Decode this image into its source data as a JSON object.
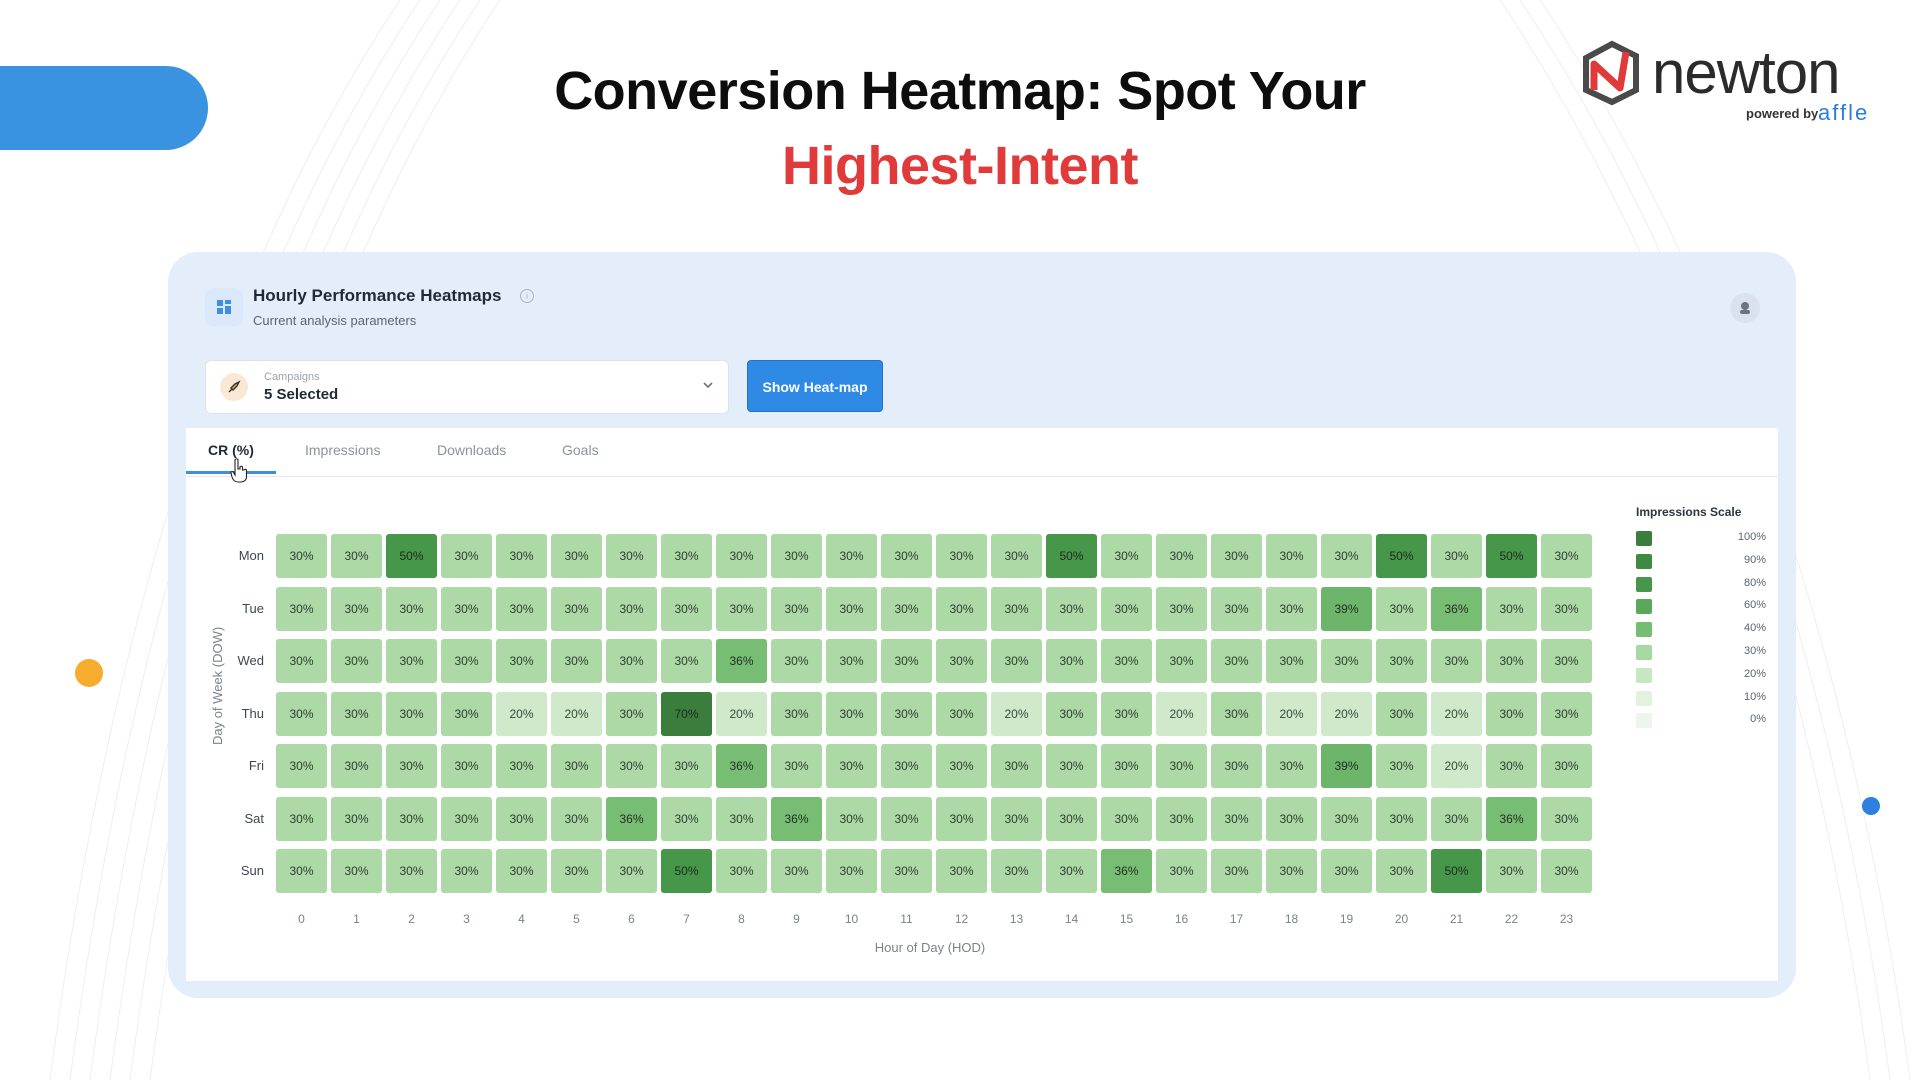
{
  "headline": {
    "line1": "Conversion Heatmap: Spot Your",
    "line2": "Highest-Intent"
  },
  "logo": {
    "word": "newton",
    "powered": "powered by",
    "brand": "affle"
  },
  "panel": {
    "title": "Hourly Performance Heatmaps",
    "subtitle": "Current analysis parameters",
    "campaign_label": "Campaigns",
    "campaign_value": "5 Selected",
    "show_button": "Show Heat-map"
  },
  "tabs": [
    {
      "label": "CR (%)",
      "active": true
    },
    {
      "label": "Impressions",
      "active": false
    },
    {
      "label": "Downloads",
      "active": false
    },
    {
      "label": "Goals",
      "active": false
    }
  ],
  "colors": {
    "accent": "#2f8ae5",
    "headline_red": "#e13a3a"
  },
  "chart_data": {
    "type": "heatmap",
    "ylabel": "Day of Week (DOW)",
    "xlabel": "Hour of Day (HOD)",
    "x": [
      "0",
      "1",
      "2",
      "3",
      "4",
      "5",
      "6",
      "7",
      "8",
      "9",
      "10",
      "11",
      "12",
      "13",
      "14",
      "15",
      "16",
      "17",
      "18",
      "19",
      "20",
      "21",
      "22",
      "23"
    ],
    "y": [
      "Mon",
      "Tue",
      "Wed",
      "Thu",
      "Fri",
      "Sat",
      "Sun"
    ],
    "values": [
      [
        30,
        30,
        50,
        30,
        30,
        30,
        30,
        30,
        30,
        30,
        30,
        30,
        30,
        30,
        50,
        30,
        30,
        30,
        30,
        30,
        50,
        30,
        50,
        30
      ],
      [
        30,
        30,
        30,
        30,
        30,
        30,
        30,
        30,
        30,
        30,
        30,
        30,
        30,
        30,
        30,
        30,
        30,
        30,
        30,
        39,
        30,
        36,
        30,
        30
      ],
      [
        30,
        30,
        30,
        30,
        30,
        30,
        30,
        30,
        36,
        30,
        30,
        30,
        30,
        30,
        30,
        30,
        30,
        30,
        30,
        30,
        30,
        30,
        30,
        30
      ],
      [
        30,
        30,
        30,
        30,
        20,
        20,
        30,
        70,
        20,
        30,
        30,
        30,
        30,
        20,
        30,
        30,
        20,
        30,
        20,
        20,
        30,
        20,
        30,
        30
      ],
      [
        30,
        30,
        30,
        30,
        30,
        30,
        30,
        30,
        36,
        30,
        30,
        30,
        30,
        30,
        30,
        30,
        30,
        30,
        30,
        39,
        30,
        20,
        30,
        30
      ],
      [
        30,
        30,
        30,
        30,
        30,
        30,
        36,
        30,
        30,
        36,
        30,
        30,
        30,
        30,
        30,
        30,
        30,
        30,
        30,
        30,
        30,
        30,
        36,
        30
      ],
      [
        30,
        30,
        30,
        30,
        30,
        30,
        30,
        50,
        30,
        30,
        30,
        30,
        30,
        30,
        30,
        36,
        30,
        30,
        30,
        30,
        30,
        50,
        30,
        30
      ]
    ],
    "legend_title": "Impressions Scale",
    "legend": [
      {
        "label": "100%",
        "color": "#3a7d3d"
      },
      {
        "label": "90%",
        "color": "#3f8a40"
      },
      {
        "label": "80%",
        "color": "#47974a"
      },
      {
        "label": "60%",
        "color": "#58a95a"
      },
      {
        "label": "40%",
        "color": "#74bd72"
      },
      {
        "label": "30%",
        "color": "#a7d8a2"
      },
      {
        "label": "20%",
        "color": "#c7e7c2"
      },
      {
        "label": "10%",
        "color": "#e2f2df"
      },
      {
        "label": "0%",
        "color": "#eef5ed"
      }
    ]
  }
}
